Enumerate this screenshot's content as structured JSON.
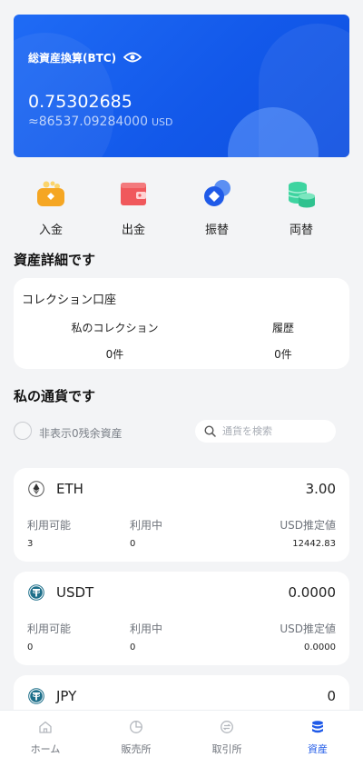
{
  "hero": {
    "title": "総資産換算(BTC)",
    "amount": "0.75302685",
    "usd_value": "≈86537.09284000",
    "usd_unit": "USD",
    "eye_icon": "eye-icon"
  },
  "actions": [
    {
      "label": "入金",
      "icon": "deposit-box-icon",
      "color": "#f5a623"
    },
    {
      "label": "出金",
      "icon": "wallet-icon",
      "color": "#f0585c"
    },
    {
      "label": "振替",
      "icon": "transfer-coins-icon",
      "color": "#1f5ae8"
    },
    {
      "label": "両替",
      "icon": "coin-stack-icon",
      "color": "#3ed4a0"
    }
  ],
  "asset_details": {
    "title": "資産詳細です",
    "collection_account": "コレクション口座",
    "my_collection_label": "私のコレクション",
    "my_collection_count": "0件",
    "history_label": "履歴",
    "history_count": "0件"
  },
  "my_currencies": {
    "title": "私の通貨です",
    "hide_zero_label": "非表示0残余資産",
    "search_placeholder": "通貨を検索"
  },
  "coins": [
    {
      "name": "ETH",
      "amount": "3.00",
      "available_label": "利用可能",
      "available": "3",
      "in_use_label": "利用中",
      "in_use": "0",
      "usd_label": "USD推定値",
      "usd": "12442.83",
      "icon": "ethereum-icon"
    },
    {
      "name": "USDT",
      "amount": "0.0000",
      "available_label": "利用可能",
      "available": "0",
      "in_use_label": "利用中",
      "in_use": "0",
      "usd_label": "USD推定値",
      "usd": "0.0000",
      "icon": "tether-icon"
    },
    {
      "name": "JPY",
      "amount": "0",
      "icon": "tether-icon"
    }
  ],
  "tabbar": [
    {
      "label": "ホーム",
      "icon": "home-icon"
    },
    {
      "label": "販売所",
      "icon": "pie-chart-icon"
    },
    {
      "label": "取引所",
      "icon": "exchange-icon"
    },
    {
      "label": "資産",
      "icon": "database-icon",
      "active": true
    }
  ],
  "colors": {
    "accent": "#1f5ae8",
    "hero_bg": "#1359ea",
    "page_bg": "#f3f4f6"
  }
}
